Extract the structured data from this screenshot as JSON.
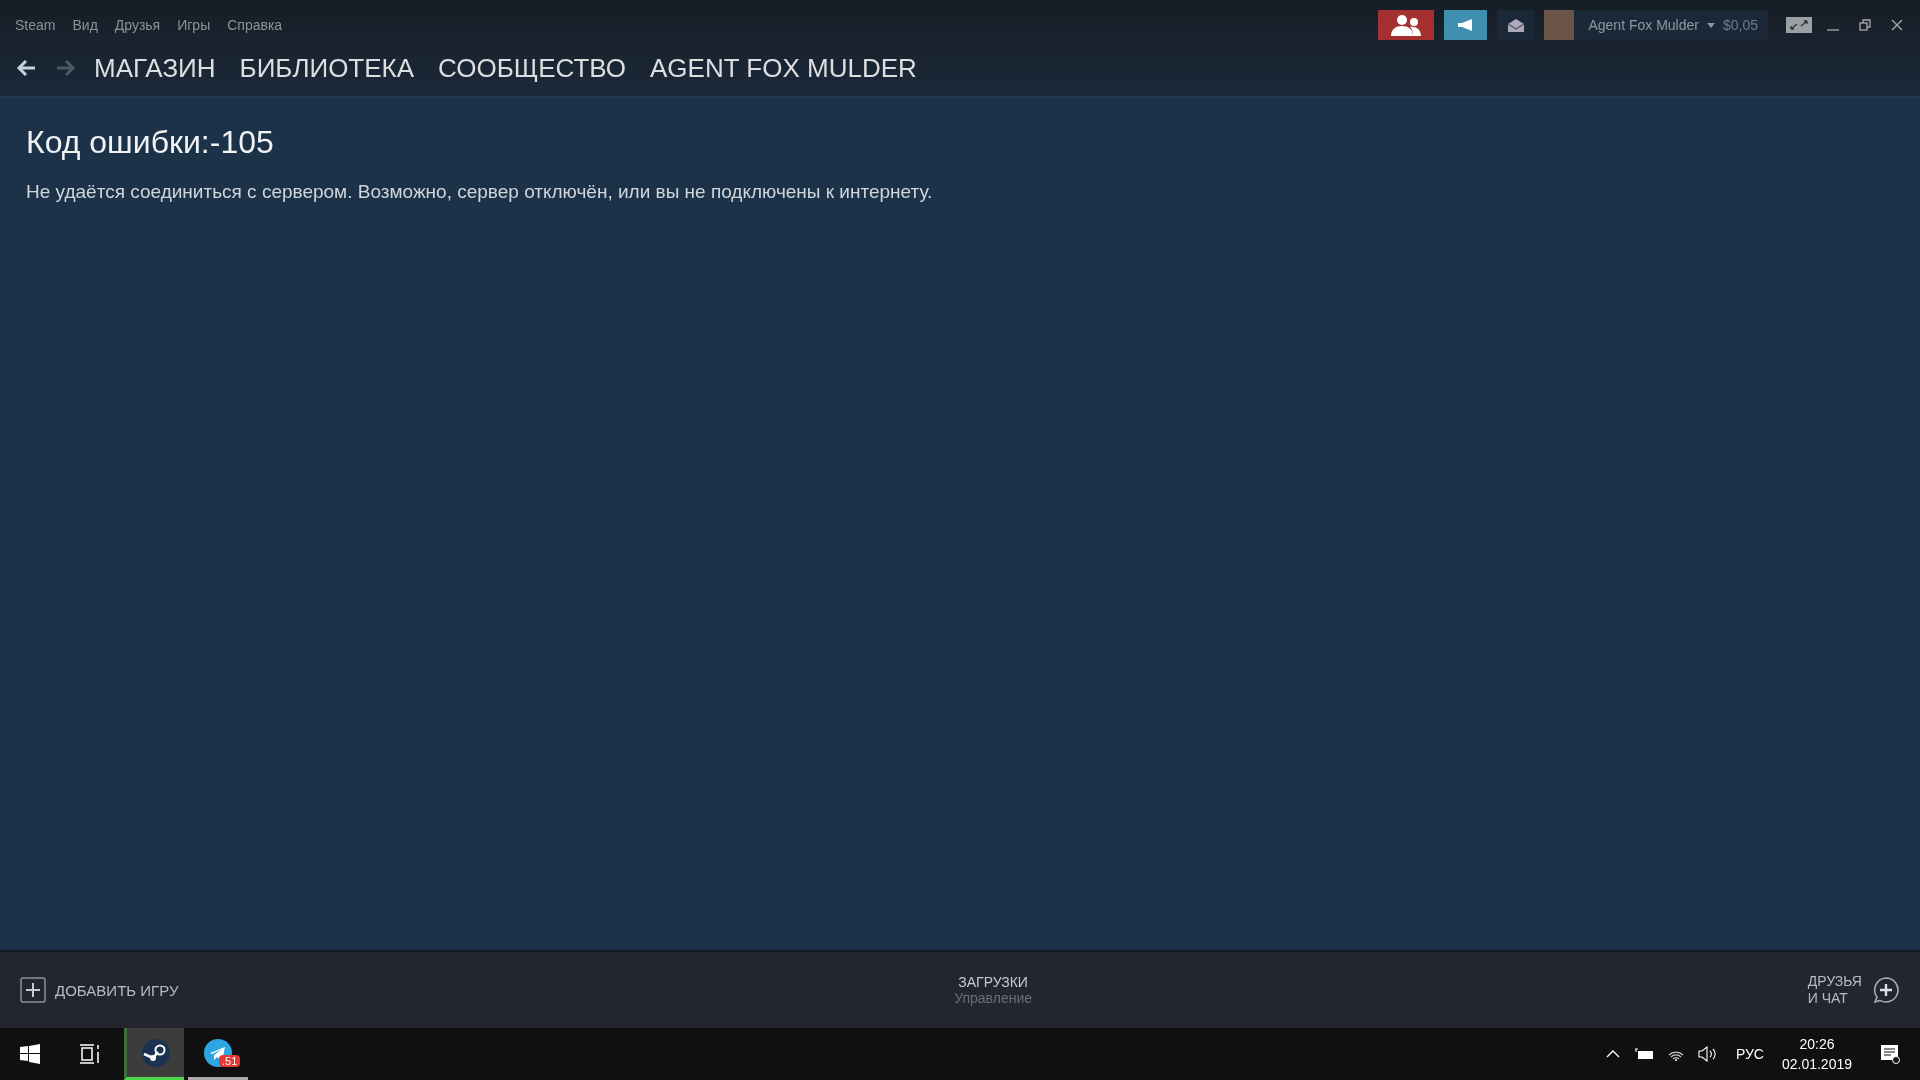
{
  "menu": [
    "Steam",
    "Вид",
    "Друзья",
    "Игры",
    "Справка"
  ],
  "nav": {
    "tabs": [
      "МАГАЗИН",
      "БИБЛИОТЕКА",
      "СООБЩЕСТВО",
      "AGENT FOX MULDER"
    ]
  },
  "account": {
    "name": "Agent Fox Mulder",
    "balance": "$0,05"
  },
  "error": {
    "title": "Код ошибки:-105",
    "message": "Не удаётся соединиться с сервером. Возможно, сервер отключён, или вы не подключены к интернету."
  },
  "bottom_bar": {
    "add_game": "ДОБАВИТЬ ИГРУ",
    "downloads": {
      "title": "ЗАГРУЗКИ",
      "subtitle": "Управление"
    },
    "friends": [
      "ДРУЗЬЯ",
      "И ЧАТ"
    ]
  },
  "taskbar": {
    "apps": [
      {
        "kind": "steam",
        "active": true
      },
      {
        "kind": "telegram",
        "active": false,
        "badge": ".51"
      }
    ],
    "language": "РУС",
    "time": "20:26",
    "date": "02.01.2019"
  }
}
